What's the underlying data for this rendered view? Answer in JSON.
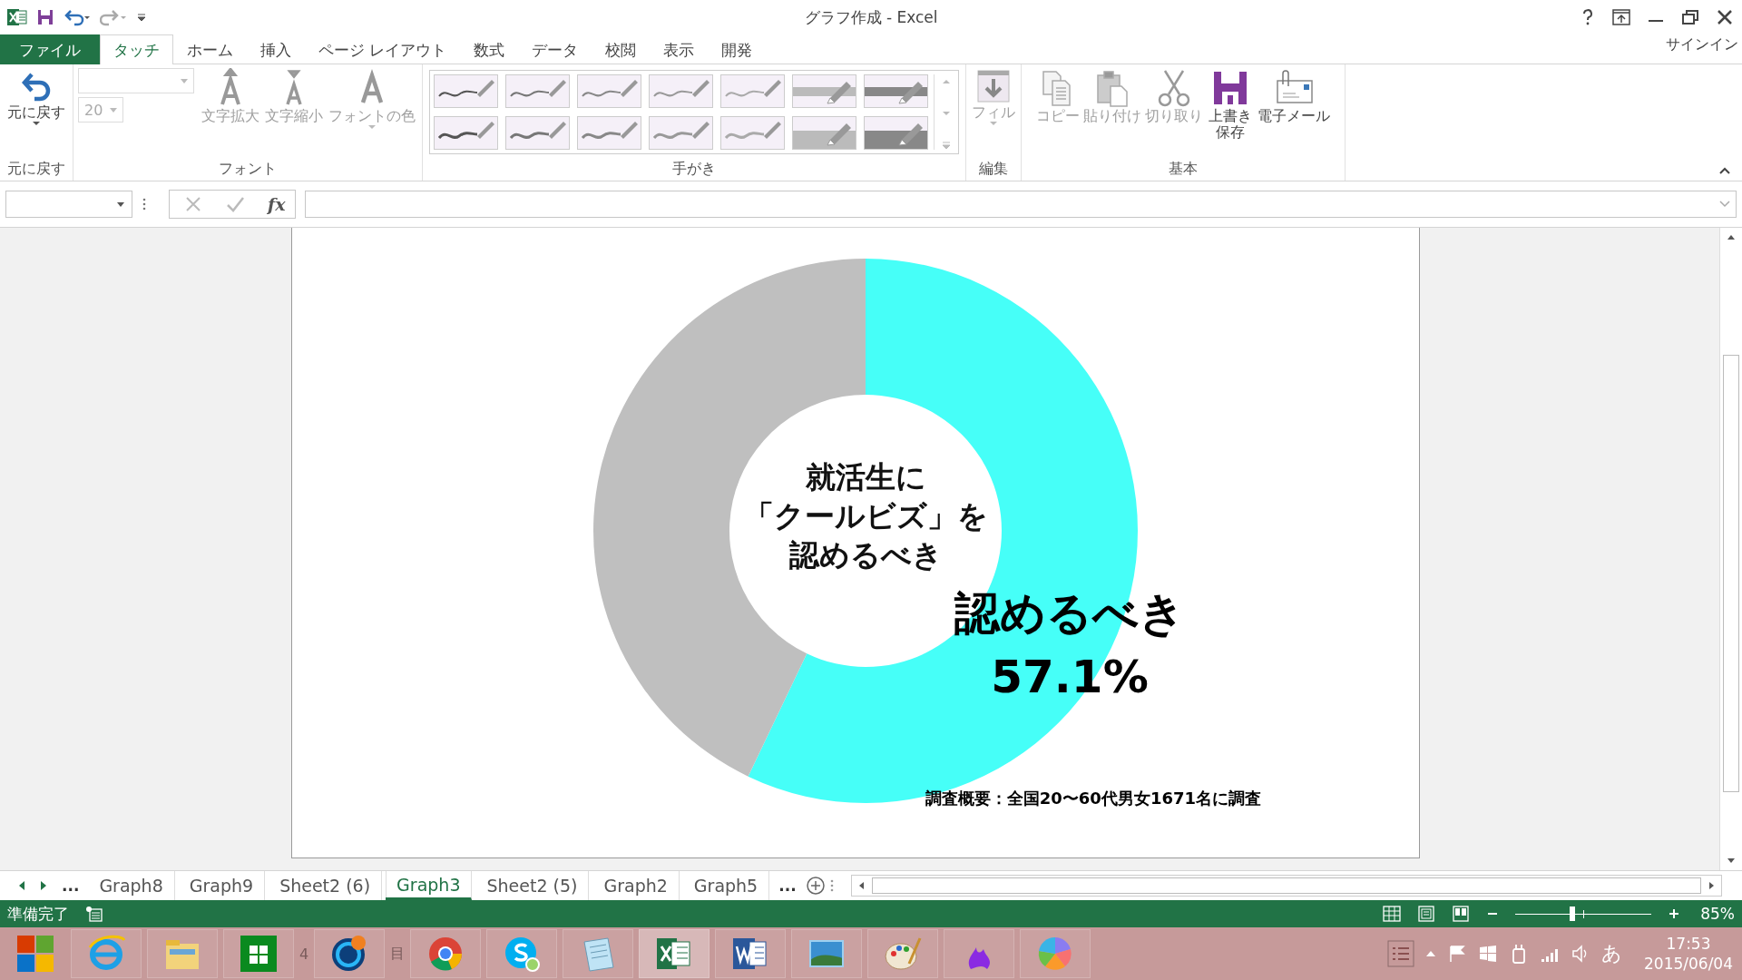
{
  "title_bar": {
    "title": "グラフ作成 - Excel"
  },
  "ribbon_tabs": [
    {
      "label": "ファイル",
      "kind": "file",
      "selected": false
    },
    {
      "label": "タッチ",
      "kind": "tab",
      "selected": true
    },
    {
      "label": "ホーム",
      "kind": "tab",
      "selected": false
    },
    {
      "label": "挿入",
      "kind": "tab",
      "selected": false
    },
    {
      "label": "ページ レイアウト",
      "kind": "tab",
      "selected": false
    },
    {
      "label": "数式",
      "kind": "tab",
      "selected": false
    },
    {
      "label": "データ",
      "kind": "tab",
      "selected": false
    },
    {
      "label": "校閲",
      "kind": "tab",
      "selected": false
    },
    {
      "label": "表示",
      "kind": "tab",
      "selected": false
    },
    {
      "label": "開発",
      "kind": "tab",
      "selected": false
    }
  ],
  "sign_in": "サインイン",
  "ribbon": {
    "undo_group": {
      "button": "元に戻す",
      "label": "元に戻す"
    },
    "font_group": {
      "font_size": "20",
      "label": "フォント",
      "buttons": [
        {
          "label": "文字拡大",
          "kind": "grow",
          "disabled": true
        },
        {
          "label": "文字縮小",
          "kind": "shrink",
          "disabled": true
        },
        {
          "label": "フォントの色",
          "kind": "color",
          "disabled": true
        }
      ]
    },
    "handwriting_group": {
      "label": "手がき"
    },
    "edit_group": {
      "label": "編集",
      "buttons": [
        {
          "label": "フィル",
          "kind": "fill",
          "disabled": true
        }
      ]
    },
    "basic_group": {
      "label": "基本",
      "buttons": [
        {
          "label": "コピー",
          "kind": "copy",
          "disabled": true
        },
        {
          "label": "貼り付け",
          "kind": "paste",
          "disabled": true
        },
        {
          "label": "切り取り",
          "kind": "cut",
          "disabled": true
        },
        {
          "label": "上書き保存",
          "kind": "save",
          "disabled": false
        },
        {
          "label": "電子メール",
          "kind": "email",
          "disabled": false
        }
      ]
    }
  },
  "formula_bar": {
    "fx": "fx"
  },
  "chart": {
    "center_lines": [
      "就活生に",
      "「クールビズ」を",
      "認めるべき"
    ],
    "slice_label": "認めるべき",
    "slice_value": "57.1%",
    "note": "調査概要：全国20〜60代男女1671名に調査",
    "chart_data": {
      "type": "donut",
      "values": [
        57.1,
        42.9
      ]
    }
  },
  "sheet_tabs": {
    "more_left": "...",
    "more_right": "...",
    "tabs": [
      {
        "label": "Graph8",
        "selected": false
      },
      {
        "label": "Graph9",
        "selected": false
      },
      {
        "label": "Sheet2 (6)",
        "selected": false
      },
      {
        "label": "Graph3",
        "selected": true
      },
      {
        "label": "Sheet2 (5)",
        "selected": false
      },
      {
        "label": "Graph2",
        "selected": false
      },
      {
        "label": "Graph5",
        "selected": false
      }
    ]
  },
  "status_bar": {
    "status": "準備完了",
    "zoom": {
      "level": 0.42,
      "reading": "85%"
    }
  },
  "taskbar": {
    "hidden_texts": [
      "4",
      "目"
    ],
    "ime": "あ",
    "time": "17:53",
    "date": "2015/06/04"
  }
}
